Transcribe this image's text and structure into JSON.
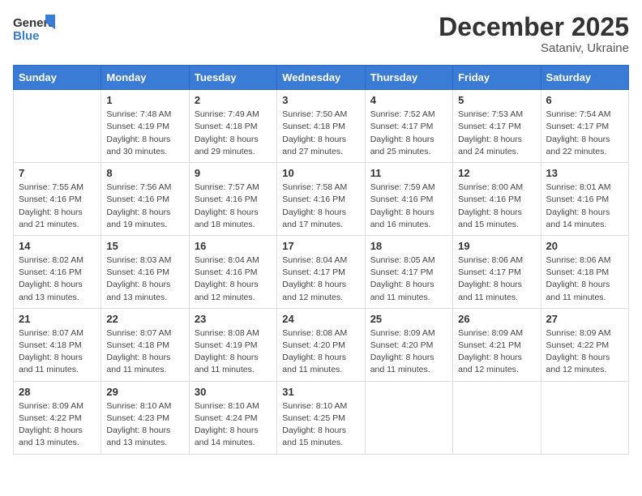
{
  "logo": {
    "general": "General",
    "blue": "Blue"
  },
  "title": "December 2025",
  "subtitle": "Sataniv, Ukraine",
  "weekdays": [
    "Sunday",
    "Monday",
    "Tuesday",
    "Wednesday",
    "Thursday",
    "Friday",
    "Saturday"
  ],
  "weeks": [
    [
      {
        "day": "",
        "info": ""
      },
      {
        "day": "1",
        "info": "Sunrise: 7:48 AM\nSunset: 4:19 PM\nDaylight: 8 hours\nand 30 minutes."
      },
      {
        "day": "2",
        "info": "Sunrise: 7:49 AM\nSunset: 4:18 PM\nDaylight: 8 hours\nand 29 minutes."
      },
      {
        "day": "3",
        "info": "Sunrise: 7:50 AM\nSunset: 4:18 PM\nDaylight: 8 hours\nand 27 minutes."
      },
      {
        "day": "4",
        "info": "Sunrise: 7:52 AM\nSunset: 4:17 PM\nDaylight: 8 hours\nand 25 minutes."
      },
      {
        "day": "5",
        "info": "Sunrise: 7:53 AM\nSunset: 4:17 PM\nDaylight: 8 hours\nand 24 minutes."
      },
      {
        "day": "6",
        "info": "Sunrise: 7:54 AM\nSunset: 4:17 PM\nDaylight: 8 hours\nand 22 minutes."
      }
    ],
    [
      {
        "day": "7",
        "info": "Sunrise: 7:55 AM\nSunset: 4:16 PM\nDaylight: 8 hours\nand 21 minutes."
      },
      {
        "day": "8",
        "info": "Sunrise: 7:56 AM\nSunset: 4:16 PM\nDaylight: 8 hours\nand 19 minutes."
      },
      {
        "day": "9",
        "info": "Sunrise: 7:57 AM\nSunset: 4:16 PM\nDaylight: 8 hours\nand 18 minutes."
      },
      {
        "day": "10",
        "info": "Sunrise: 7:58 AM\nSunset: 4:16 PM\nDaylight: 8 hours\nand 17 minutes."
      },
      {
        "day": "11",
        "info": "Sunrise: 7:59 AM\nSunset: 4:16 PM\nDaylight: 8 hours\nand 16 minutes."
      },
      {
        "day": "12",
        "info": "Sunrise: 8:00 AM\nSunset: 4:16 PM\nDaylight: 8 hours\nand 15 minutes."
      },
      {
        "day": "13",
        "info": "Sunrise: 8:01 AM\nSunset: 4:16 PM\nDaylight: 8 hours\nand 14 minutes."
      }
    ],
    [
      {
        "day": "14",
        "info": "Sunrise: 8:02 AM\nSunset: 4:16 PM\nDaylight: 8 hours\nand 13 minutes."
      },
      {
        "day": "15",
        "info": "Sunrise: 8:03 AM\nSunset: 4:16 PM\nDaylight: 8 hours\nand 13 minutes."
      },
      {
        "day": "16",
        "info": "Sunrise: 8:04 AM\nSunset: 4:16 PM\nDaylight: 8 hours\nand 12 minutes."
      },
      {
        "day": "17",
        "info": "Sunrise: 8:04 AM\nSunset: 4:17 PM\nDaylight: 8 hours\nand 12 minutes."
      },
      {
        "day": "18",
        "info": "Sunrise: 8:05 AM\nSunset: 4:17 PM\nDaylight: 8 hours\nand 11 minutes."
      },
      {
        "day": "19",
        "info": "Sunrise: 8:06 AM\nSunset: 4:17 PM\nDaylight: 8 hours\nand 11 minutes."
      },
      {
        "day": "20",
        "info": "Sunrise: 8:06 AM\nSunset: 4:18 PM\nDaylight: 8 hours\nand 11 minutes."
      }
    ],
    [
      {
        "day": "21",
        "info": "Sunrise: 8:07 AM\nSunset: 4:18 PM\nDaylight: 8 hours\nand 11 minutes."
      },
      {
        "day": "22",
        "info": "Sunrise: 8:07 AM\nSunset: 4:18 PM\nDaylight: 8 hours\nand 11 minutes."
      },
      {
        "day": "23",
        "info": "Sunrise: 8:08 AM\nSunset: 4:19 PM\nDaylight: 8 hours\nand 11 minutes."
      },
      {
        "day": "24",
        "info": "Sunrise: 8:08 AM\nSunset: 4:20 PM\nDaylight: 8 hours\nand 11 minutes."
      },
      {
        "day": "25",
        "info": "Sunrise: 8:09 AM\nSunset: 4:20 PM\nDaylight: 8 hours\nand 11 minutes."
      },
      {
        "day": "26",
        "info": "Sunrise: 8:09 AM\nSunset: 4:21 PM\nDaylight: 8 hours\nand 12 minutes."
      },
      {
        "day": "27",
        "info": "Sunrise: 8:09 AM\nSunset: 4:22 PM\nDaylight: 8 hours\nand 12 minutes."
      }
    ],
    [
      {
        "day": "28",
        "info": "Sunrise: 8:09 AM\nSunset: 4:22 PM\nDaylight: 8 hours\nand 13 minutes."
      },
      {
        "day": "29",
        "info": "Sunrise: 8:10 AM\nSunset: 4:23 PM\nDaylight: 8 hours\nand 13 minutes."
      },
      {
        "day": "30",
        "info": "Sunrise: 8:10 AM\nSunset: 4:24 PM\nDaylight: 8 hours\nand 14 minutes."
      },
      {
        "day": "31",
        "info": "Sunrise: 8:10 AM\nSunset: 4:25 PM\nDaylight: 8 hours\nand 15 minutes."
      },
      {
        "day": "",
        "info": ""
      },
      {
        "day": "",
        "info": ""
      },
      {
        "day": "",
        "info": ""
      }
    ]
  ]
}
